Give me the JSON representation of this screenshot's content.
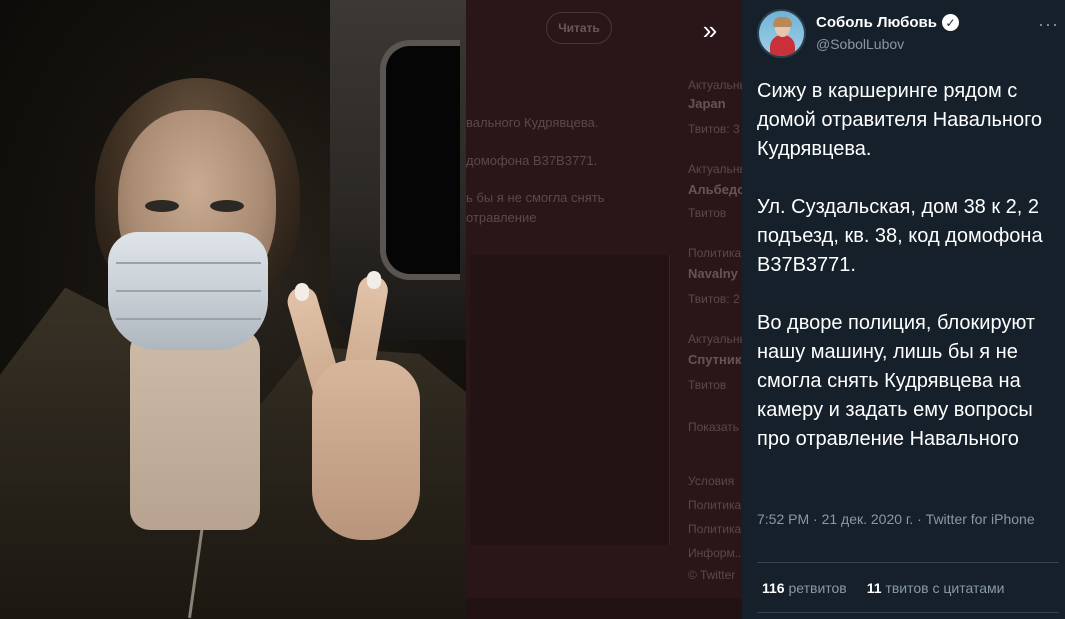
{
  "background": {
    "read_button": "Читать",
    "lines": [
      "вального Кудрявцева.",
      "домофона В37В3771.",
      "ь бы я не смогла снять",
      "отравление"
    ],
    "side_items": [
      {
        "label": "Актуальные темы",
        "title": "Japan",
        "sub": "Твитов: 3"
      },
      {
        "label": "Актуальные темы",
        "title": "Альбедо",
        "sub": "Твитов"
      },
      {
        "label": "Политика",
        "title": "Navalny",
        "sub": "Твитов: 2"
      },
      {
        "label": "Актуальные темы",
        "title": "Спутник",
        "sub": "Твитов"
      },
      {
        "label": "Показать еще",
        "title": "",
        "sub": ""
      }
    ],
    "footer": [
      "Условия",
      "Политика",
      "Политика",
      "Информ...",
      "© Twitter"
    ]
  },
  "expand_icon": "double-chevron-right-icon",
  "tweet": {
    "author_name": "Соболь Любовь",
    "verified_icon": "verified-badge-icon",
    "handle": "@SobolLubov",
    "more_icon": "more-horizontal-icon",
    "text": "Сижу в каршеринге рядом с домой отравителя Навального Кудрявцева.\n\nУл. Суздальская, дом 38 к 2, 2 подъезд, кв. 38, код домофона В37В3771.\n\nВо дворе полиция, блокируют нашу машину, лишь бы я не смогла снять Кудрявцева на камеру и задать ему вопросы про отравление Навального",
    "meta": "7:52 PM · 21 дек. 2020 г. · Twitter for iPhone",
    "retweets_count": "116",
    "retweets_label": "ретвитов",
    "quotes_count": "11",
    "quotes_label": "твитов с цитатами"
  },
  "colors": {
    "panel_bg": "#15202b",
    "muted_text": "#8899a6",
    "divider": "#38444d",
    "dim_overlay": "#2a1618"
  }
}
